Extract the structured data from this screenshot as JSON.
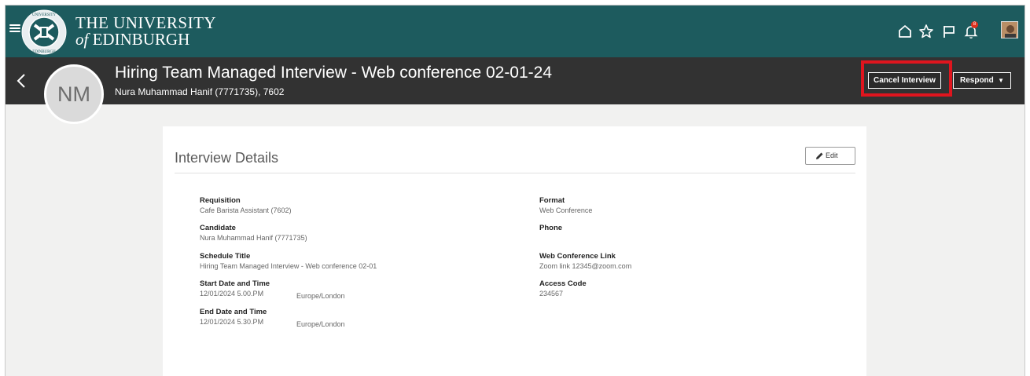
{
  "brand": {
    "line1": "THE UNIVERSITY",
    "line2_prefix": "of",
    "line2_name": "EDINBURGH",
    "bar_color": "#1d5b5e"
  },
  "topbar": {
    "icons": [
      "home-icon",
      "star-icon",
      "flag-icon",
      "bell-icon",
      "user-avatar"
    ],
    "notification_count": "8"
  },
  "header": {
    "avatar_initials": "NM",
    "title": "Hiring Team Managed Interview - Web conference 02-01-24",
    "subtitle": "Nura Muhammad Hanif (7771735), 7602",
    "cancel_label": "Cancel Interview",
    "respond_label": "Respond",
    "highlight_color": "#e0151e"
  },
  "details": {
    "title": "Interview Details",
    "edit_label": "Edit",
    "requisition": {
      "label": "Requisition",
      "value": "Cafe Barista Assistant (7602)"
    },
    "candidate": {
      "label": "Candidate",
      "value": "Nura Muhammad Hanif (7771735)"
    },
    "schedule_title": {
      "label": "Schedule Title",
      "value": "Hiring Team Managed Interview - Web conference 02-01"
    },
    "start": {
      "label": "Start Date and Time",
      "value": "12/01/2024 5.00.PM",
      "tz": "Europe/London"
    },
    "end": {
      "label": "End Date and Time",
      "value": "12/01/2024 5.30.PM",
      "tz": "Europe/London"
    },
    "format": {
      "label": "Format",
      "value": "Web Conference"
    },
    "phone": {
      "label": "Phone",
      "value": ""
    },
    "web_link": {
      "label": "Web Conference Link",
      "value": "Zoom link 12345@zoom.com"
    },
    "access_code": {
      "label": "Access Code",
      "value": "234567"
    }
  }
}
